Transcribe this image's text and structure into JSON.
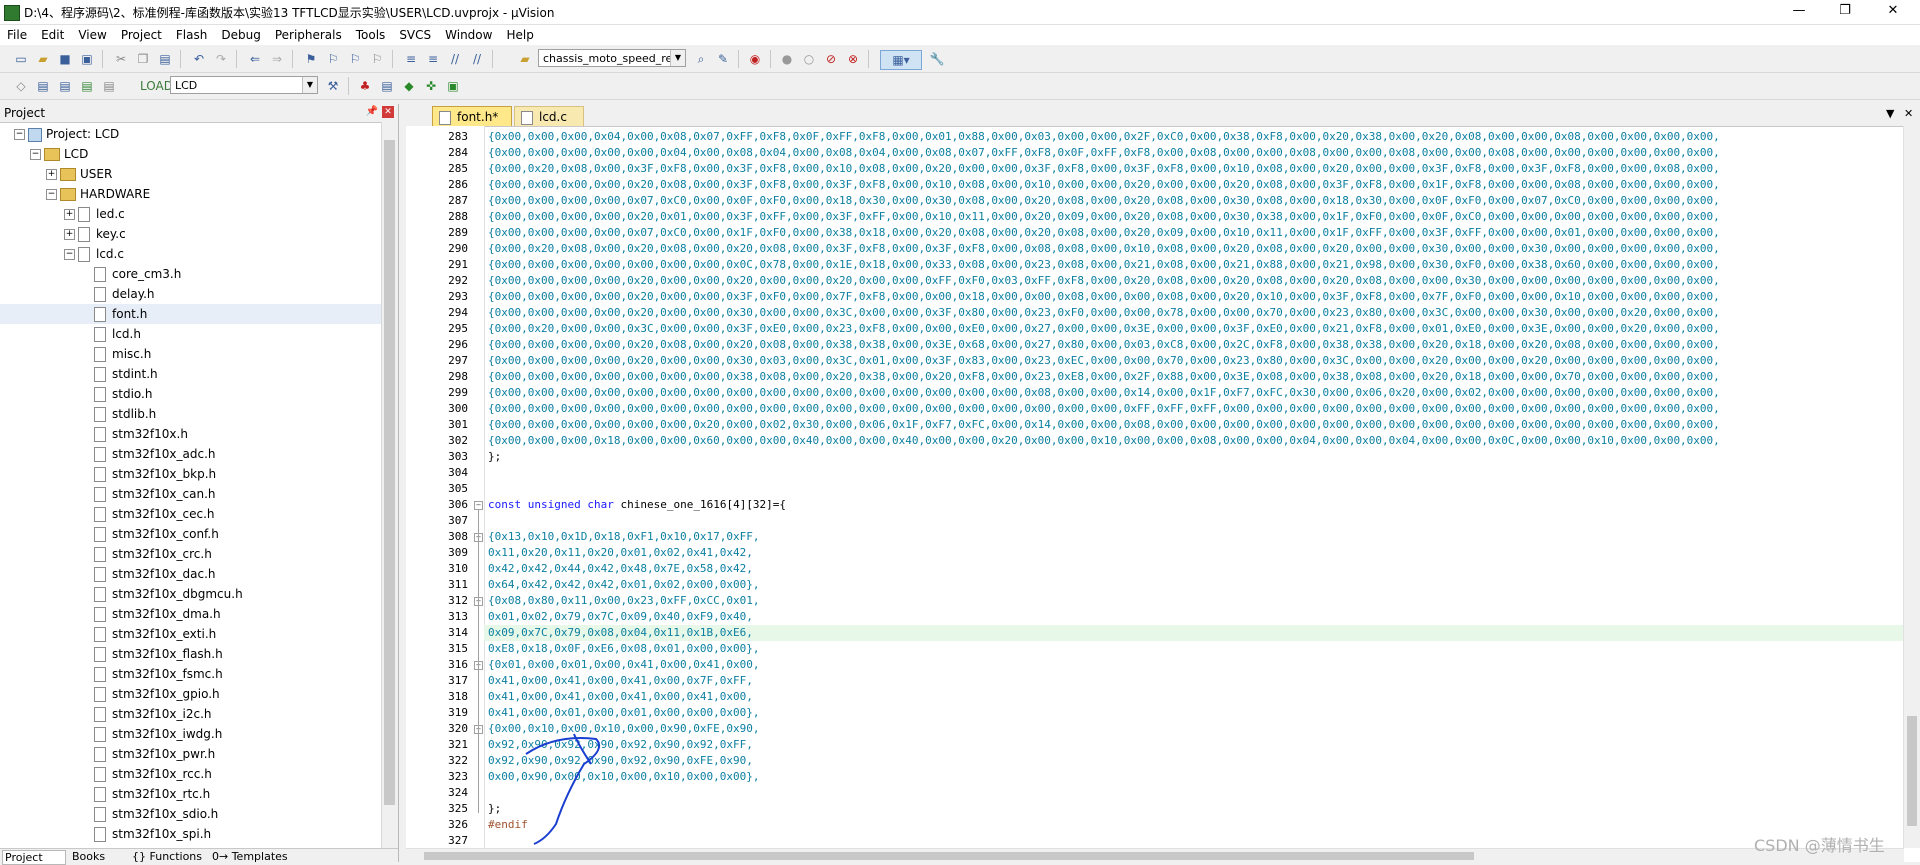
{
  "window": {
    "title": "D:\\4、程序源码\\2、标准例程-库函数版本\\实验13 TFTLCD显示实验\\USER\\LCD.uvprojx - µVision",
    "minimize": "—",
    "maximize": "❐",
    "close": "✕"
  },
  "menu": [
    "File",
    "Edit",
    "View",
    "Project",
    "Flash",
    "Debug",
    "Peripherals",
    "Tools",
    "SVCS",
    "Window",
    "Help"
  ],
  "toolbar": {
    "target_combo": "chassis_moto_speed_ref",
    "build_target": "LCD"
  },
  "project_panel": {
    "title": "Project",
    "tree": [
      {
        "label": "Project: LCD",
        "icon": "project-icon",
        "level": 0,
        "expander": "−"
      },
      {
        "label": "LCD",
        "icon": "target-folder-icon",
        "level": 1,
        "expander": "−"
      },
      {
        "label": "USER",
        "icon": "folder-icon",
        "level": 2,
        "expander": "+"
      },
      {
        "label": "HARDWARE",
        "icon": "folder-icon",
        "level": 2,
        "expander": "−"
      },
      {
        "label": "led.c",
        "icon": "file-icon",
        "level": 3,
        "expander": "+"
      },
      {
        "label": "key.c",
        "icon": "file-icon",
        "level": 3,
        "expander": "+"
      },
      {
        "label": "lcd.c",
        "icon": "file-icon",
        "level": 3,
        "expander": "−"
      },
      {
        "label": "core_cm3.h",
        "icon": "file-icon",
        "level": 4
      },
      {
        "label": "delay.h",
        "icon": "file-icon",
        "level": 4
      },
      {
        "label": "font.h",
        "icon": "file-icon",
        "level": 4,
        "selected": true
      },
      {
        "label": "lcd.h",
        "icon": "file-icon",
        "level": 4
      },
      {
        "label": "misc.h",
        "icon": "file-icon",
        "level": 4
      },
      {
        "label": "stdint.h",
        "icon": "file-icon",
        "level": 4
      },
      {
        "label": "stdio.h",
        "icon": "file-icon",
        "level": 4
      },
      {
        "label": "stdlib.h",
        "icon": "file-icon",
        "level": 4
      },
      {
        "label": "stm32f10x.h",
        "icon": "file-icon",
        "level": 4
      },
      {
        "label": "stm32f10x_adc.h",
        "icon": "file-icon",
        "level": 4
      },
      {
        "label": "stm32f10x_bkp.h",
        "icon": "file-icon",
        "level": 4
      },
      {
        "label": "stm32f10x_can.h",
        "icon": "file-icon",
        "level": 4
      },
      {
        "label": "stm32f10x_cec.h",
        "icon": "file-icon",
        "level": 4
      },
      {
        "label": "stm32f10x_conf.h",
        "icon": "file-icon",
        "level": 4
      },
      {
        "label": "stm32f10x_crc.h",
        "icon": "file-icon",
        "level": 4
      },
      {
        "label": "stm32f10x_dac.h",
        "icon": "file-icon",
        "level": 4
      },
      {
        "label": "stm32f10x_dbgmcu.h",
        "icon": "file-icon",
        "level": 4
      },
      {
        "label": "stm32f10x_dma.h",
        "icon": "file-icon",
        "level": 4
      },
      {
        "label": "stm32f10x_exti.h",
        "icon": "file-icon",
        "level": 4
      },
      {
        "label": "stm32f10x_flash.h",
        "icon": "file-icon",
        "level": 4
      },
      {
        "label": "stm32f10x_fsmc.h",
        "icon": "file-icon",
        "level": 4
      },
      {
        "label": "stm32f10x_gpio.h",
        "icon": "file-icon",
        "level": 4
      },
      {
        "label": "stm32f10x_i2c.h",
        "icon": "file-icon",
        "level": 4
      },
      {
        "label": "stm32f10x_iwdg.h",
        "icon": "file-icon",
        "level": 4
      },
      {
        "label": "stm32f10x_pwr.h",
        "icon": "file-icon",
        "level": 4
      },
      {
        "label": "stm32f10x_rcc.h",
        "icon": "file-icon",
        "level": 4
      },
      {
        "label": "stm32f10x_rtc.h",
        "icon": "file-icon",
        "level": 4
      },
      {
        "label": "stm32f10x_sdio.h",
        "icon": "file-icon",
        "level": 4
      },
      {
        "label": "stm32f10x_spi.h",
        "icon": "file-icon",
        "level": 4
      }
    ],
    "bottom_tabs": [
      "Project",
      "Books",
      "{} Functions",
      "0→ Templates"
    ]
  },
  "editor": {
    "tabs": [
      {
        "label": "font.h*",
        "active": true
      },
      {
        "label": "lcd.c",
        "active": false
      }
    ],
    "highlighted_line": "314",
    "lines": [
      {
        "n": "283",
        "text": "{0x00,0x00,0x00,0x04,0x00,0x08,0x07,0xFF,0xF8,0x0F,0xFF,0xF8,0x00,0x01,0x88,0x00,0x03,0x00,0x00,0x2F,0xC0,0x00,0x38,0xF8,0x00,0x20,0x38,0x00,0x20,0x08,0x00,0x00,0x08,0x00,0x00,0x00,0x00,"
      },
      {
        "n": "284",
        "text": "{0x00,0x00,0x00,0x00,0x00,0x04,0x00,0x08,0x04,0x00,0x08,0x04,0x00,0x08,0x07,0xFF,0xF8,0x0F,0xFF,0xF8,0x00,0x08,0x00,0x00,0x08,0x00,0x00,0x08,0x00,0x00,0x08,0x00,0x00,0x00,0x00,0x00,0x00,"
      },
      {
        "n": "285",
        "text": "{0x00,0x20,0x08,0x00,0x3F,0xF8,0x00,0x3F,0xF8,0x00,0x10,0x08,0x00,0x20,0x00,0x00,0x3F,0xF8,0x00,0x3F,0xF8,0x00,0x10,0x08,0x00,0x20,0x00,0x00,0x3F,0xF8,0x00,0x3F,0xF8,0x00,0x00,0x08,0x00,"
      },
      {
        "n": "286",
        "text": "{0x00,0x00,0x00,0x00,0x20,0x08,0x00,0x3F,0xF8,0x00,0x3F,0xF8,0x00,0x10,0x08,0x00,0x10,0x00,0x00,0x20,0x00,0x00,0x20,0x08,0x00,0x3F,0xF8,0x00,0x1F,0xF8,0x00,0x00,0x08,0x00,0x00,0x00,0x00,"
      },
      {
        "n": "287",
        "text": "{0x00,0x00,0x00,0x00,0x07,0xC0,0x00,0x0F,0xF0,0x00,0x18,0x30,0x00,0x30,0x08,0x00,0x20,0x08,0x00,0x20,0x08,0x00,0x30,0x08,0x00,0x18,0x30,0x00,0x0F,0xF0,0x00,0x07,0xC0,0x00,0x00,0x00,0x00,"
      },
      {
        "n": "288",
        "text": "{0x00,0x00,0x00,0x00,0x20,0x01,0x00,0x3F,0xFF,0x00,0x3F,0xFF,0x00,0x10,0x11,0x00,0x20,0x09,0x00,0x20,0x08,0x00,0x30,0x38,0x00,0x1F,0xF0,0x00,0x0F,0xC0,0x00,0x00,0x00,0x00,0x00,0x00,0x00,"
      },
      {
        "n": "289",
        "text": "{0x00,0x00,0x00,0x00,0x07,0xC0,0x00,0x1F,0xF0,0x00,0x38,0x18,0x00,0x20,0x08,0x00,0x20,0x08,0x00,0x20,0x09,0x00,0x10,0x11,0x00,0x1F,0xFF,0x00,0x3F,0xFF,0x00,0x00,0x01,0x00,0x00,0x00,0x00,"
      },
      {
        "n": "290",
        "text": "{0x00,0x20,0x08,0x00,0x20,0x08,0x00,0x20,0x08,0x00,0x3F,0xF8,0x00,0x3F,0xF8,0x00,0x08,0x08,0x00,0x10,0x08,0x00,0x20,0x08,0x00,0x20,0x00,0x00,0x30,0x00,0x00,0x30,0x00,0x00,0x00,0x00,0x00,"
      },
      {
        "n": "291",
        "text": "{0x00,0x00,0x00,0x00,0x00,0x00,0x00,0x0C,0x78,0x00,0x1E,0x18,0x00,0x33,0x08,0x00,0x23,0x08,0x00,0x21,0x08,0x00,0x21,0x88,0x00,0x21,0x98,0x00,0x30,0xF0,0x00,0x38,0x60,0x00,0x00,0x00,0x00,"
      },
      {
        "n": "292",
        "text": "{0x00,0x00,0x00,0x00,0x20,0x00,0x00,0x20,0x00,0x00,0x20,0x00,0x00,0xFF,0xF0,0x03,0xFF,0xF8,0x00,0x20,0x08,0x00,0x20,0x08,0x00,0x20,0x08,0x00,0x00,0x30,0x00,0x00,0x00,0x00,0x00,0x00,0x00,"
      },
      {
        "n": "293",
        "text": "{0x00,0x00,0x00,0x00,0x20,0x00,0x00,0x3F,0xF0,0x00,0x7F,0xF8,0x00,0x00,0x18,0x00,0x00,0x08,0x00,0x00,0x08,0x00,0x20,0x10,0x00,0x3F,0xF8,0x00,0x7F,0xF0,0x00,0x00,0x10,0x00,0x00,0x00,0x00,"
      },
      {
        "n": "294",
        "text": "{0x00,0x00,0x00,0x00,0x20,0x00,0x00,0x30,0x00,0x00,0x3C,0x00,0x00,0x3F,0x80,0x00,0x23,0xF0,0x00,0x00,0x78,0x00,0x00,0x70,0x00,0x23,0x80,0x00,0x3C,0x00,0x00,0x30,0x00,0x00,0x20,0x00,0x00,"
      },
      {
        "n": "295",
        "text": "{0x00,0x20,0x00,0x00,0x3C,0x00,0x00,0x3F,0xE0,0x00,0x23,0xF8,0x00,0x00,0xE0,0x00,0x27,0x00,0x00,0x3E,0x00,0x00,0x3F,0xE0,0x00,0x21,0xF8,0x00,0x01,0xE0,0x00,0x3E,0x00,0x00,0x20,0x00,0x00,"
      },
      {
        "n": "296",
        "text": "{0x00,0x00,0x00,0x00,0x20,0x08,0x00,0x20,0x08,0x00,0x38,0x38,0x00,0x3E,0x68,0x00,0x27,0x80,0x00,0x03,0xC8,0x00,0x2C,0xF8,0x00,0x38,0x38,0x00,0x20,0x18,0x00,0x20,0x08,0x00,0x00,0x00,0x00,"
      },
      {
        "n": "297",
        "text": "{0x00,0x00,0x00,0x00,0x20,0x00,0x00,0x30,0x03,0x00,0x3C,0x01,0x00,0x3F,0x83,0x00,0x23,0xEC,0x00,0x00,0x70,0x00,0x23,0x80,0x00,0x3C,0x00,0x00,0x20,0x00,0x00,0x20,0x00,0x00,0x00,0x00,0x00,"
      },
      {
        "n": "298",
        "text": "{0x00,0x00,0x00,0x00,0x00,0x00,0x00,0x38,0x08,0x00,0x20,0x38,0x00,0x20,0xF8,0x00,0x23,0xE8,0x00,0x2F,0x88,0x00,0x3E,0x08,0x00,0x38,0x08,0x00,0x20,0x18,0x00,0x00,0x70,0x00,0x00,0x00,0x00,"
      },
      {
        "n": "299",
        "text": "{0x00,0x00,0x00,0x00,0x00,0x00,0x00,0x00,0x00,0x00,0x00,0x00,0x00,0x00,0x00,0x00,0x08,0x00,0x00,0x14,0x00,0x1F,0xF7,0xFC,0x30,0x00,0x06,0x20,0x00,0x02,0x00,0x00,0x00,0x00,0x00,0x00,0x00,"
      },
      {
        "n": "300",
        "text": "{0x00,0x00,0x00,0x00,0x00,0x00,0x00,0x00,0x00,0x00,0x00,0x00,0x00,0x00,0x00,0x00,0x00,0x00,0x00,0xFF,0xFF,0xFF,0x00,0x00,0x00,0x00,0x00,0x00,0x00,0x00,0x00,0x00,0x00,0x00,0x00,0x00,0x00,"
      },
      {
        "n": "301",
        "text": "{0x00,0x00,0x00,0x00,0x00,0x00,0x20,0x00,0x02,0x30,0x00,0x06,0x1F,0xF7,0xFC,0x00,0x14,0x00,0x00,0x08,0x00,0x00,0x00,0x00,0x00,0x00,0x00,0x00,0x00,0x00,0x00,0x00,0x00,0x00,0x00,0x00,0x00,"
      },
      {
        "n": "302",
        "text": "{0x00,0x00,0x00,0x18,0x00,0x00,0x60,0x00,0x00,0x40,0x00,0x00,0x40,0x00,0x00,0x20,0x00,0x00,0x10,0x00,0x00,0x08,0x00,0x00,0x04,0x00,0x00,0x04,0x00,0x00,0x0C,0x00,0x00,0x10,0x00,0x00,0x00,"
      },
      {
        "n": "303",
        "text": "};"
      },
      {
        "n": "304",
        "text": ""
      },
      {
        "n": "305",
        "text": ""
      },
      {
        "n": "306",
        "text": "const unsigned char chinese_one_1616[4][32]={"
      },
      {
        "n": "307",
        "text": ""
      },
      {
        "n": "308",
        "text": "{0x13,0x10,0x1D,0x18,0xF1,0x10,0x17,0xFF,"
      },
      {
        "n": "309",
        "text": "0x11,0x20,0x11,0x20,0x01,0x02,0x41,0x42,"
      },
      {
        "n": "310",
        "text": "0x42,0x42,0x44,0x42,0x48,0x7E,0x58,0x42,"
      },
      {
        "n": "311",
        "text": "0x64,0x42,0x42,0x42,0x01,0x02,0x00,0x00},"
      },
      {
        "n": "312",
        "text": "{0x08,0x80,0x11,0x00,0x23,0xFF,0xCC,0x01,"
      },
      {
        "n": "313",
        "text": "0x01,0x02,0x79,0x7C,0x09,0x40,0xF9,0x40,"
      },
      {
        "n": "314",
        "text": "0x09,0x7C,0x79,0x08,0x04,0x11,0x1B,0xE6,"
      },
      {
        "n": "315",
        "text": "0xE8,0x18,0x0F,0xE6,0x08,0x01,0x00,0x00},"
      },
      {
        "n": "316",
        "text": "{0x01,0x00,0x01,0x00,0x41,0x00,0x41,0x00,"
      },
      {
        "n": "317",
        "text": "0x41,0x00,0x41,0x00,0x41,0x00,0x7F,0xFF,"
      },
      {
        "n": "318",
        "text": "0x41,0x00,0x41,0x00,0x41,0x00,0x41,0x00,"
      },
      {
        "n": "319",
        "text": "0x41,0x00,0x01,0x00,0x01,0x00,0x00,0x00},"
      },
      {
        "n": "320",
        "text": "{0x00,0x10,0x00,0x10,0x00,0x90,0xFE,0x90,"
      },
      {
        "n": "321",
        "text": "0x92,0x90,0x92,0x90,0x92,0x90,0x92,0xFF,"
      },
      {
        "n": "322",
        "text": "0x92,0x90,0x92,0x90,0x92,0x90,0xFE,0x90,"
      },
      {
        "n": "323",
        "text": "0x00,0x90,0x00,0x10,0x00,0x10,0x00,0x00},"
      },
      {
        "n": "324",
        "text": ""
      },
      {
        "n": "325",
        "text": "};"
      },
      {
        "n": "326",
        "text": "#endif"
      },
      {
        "n": "327",
        "text": ""
      }
    ]
  },
  "watermark": "CSDN @薄情书生"
}
